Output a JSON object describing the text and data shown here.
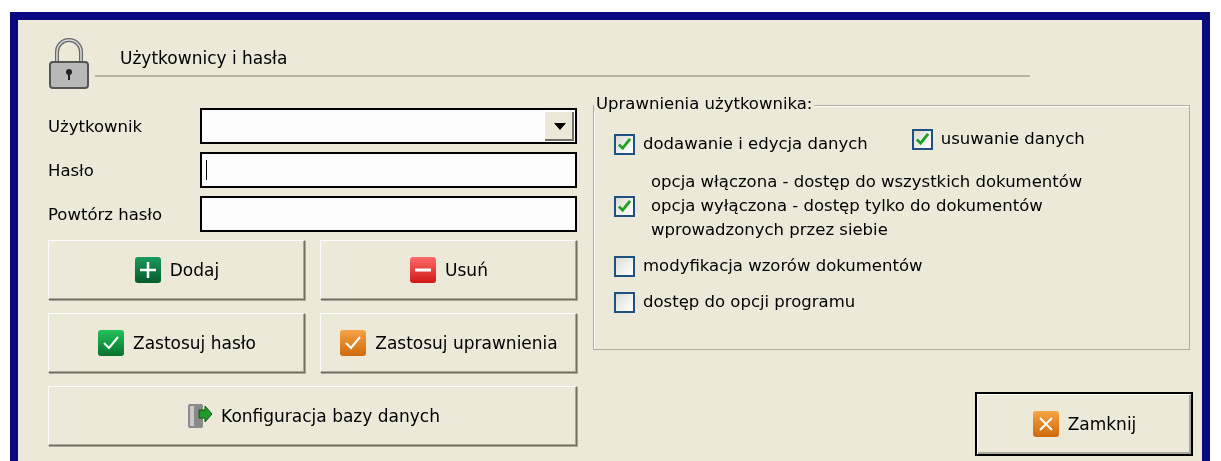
{
  "header": {
    "title": "Użytkownicy i hasła"
  },
  "fields": [
    {
      "label": "Użytkownik",
      "kind": "dropdown",
      "focused": false
    },
    {
      "label": "Hasło",
      "kind": "text",
      "focused": true
    },
    {
      "label": "Powtórz hasło",
      "kind": "text",
      "focused": false
    }
  ],
  "button_rows": [
    [
      {
        "label": "Dodaj",
        "kind": "add"
      },
      {
        "label": "Usuń",
        "kind": "remove"
      }
    ],
    [
      {
        "label": "Zastosuj hasło",
        "kind": "apply-green"
      },
      {
        "label": "Zastosuj uprawnienia",
        "kind": "apply-orange"
      }
    ],
    [
      {
        "label": "Konfiguracja bazy danych",
        "kind": "database"
      }
    ]
  ],
  "permissions": {
    "title": "Uprawnienia użytkownika:",
    "rows": [
      [
        {
          "label": "dodawanie i edycja danych",
          "checked": true
        },
        {
          "label": "usuwanie danych",
          "checked": true
        }
      ],
      [
        {
          "label": "opcja włączona - dostęp do wszystkich dokumentów\nopcja wyłączona - dostęp tylko do dokumentów\nwprowadzonych przez siebie",
          "checked": true
        }
      ],
      [
        {
          "label": "modyfikacja wzorów dokumentów",
          "checked": false
        }
      ],
      [
        {
          "label": "dostęp do opcji programu",
          "checked": false
        }
      ]
    ]
  },
  "close_button": {
    "label": "Zamknij",
    "kind": "close"
  }
}
